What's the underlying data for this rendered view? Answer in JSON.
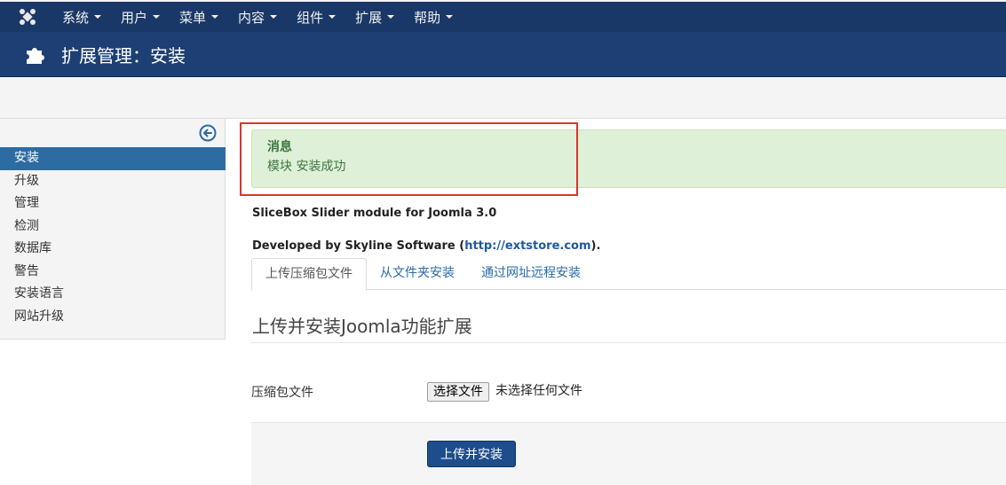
{
  "nav": {
    "items": [
      {
        "label": "系统"
      },
      {
        "label": "用户"
      },
      {
        "label": "菜单"
      },
      {
        "label": "内容"
      },
      {
        "label": "组件"
      },
      {
        "label": "扩展"
      },
      {
        "label": "帮助"
      }
    ]
  },
  "header": {
    "title": "扩展管理：安装"
  },
  "sidebar": {
    "items": [
      {
        "label": "安装",
        "active": true
      },
      {
        "label": "升级"
      },
      {
        "label": "管理"
      },
      {
        "label": "检测"
      },
      {
        "label": "数据库"
      },
      {
        "label": "警告"
      },
      {
        "label": "安装语言"
      },
      {
        "label": "网站升级"
      }
    ]
  },
  "alert": {
    "heading": "消息",
    "message": "模块 安装成功"
  },
  "description": {
    "line1": "SliceBox Slider module for Joomla 3.0",
    "line2_prefix": "Developed by Skyline Software (",
    "line2_link": "http://extstore.com",
    "line2_suffix": ")."
  },
  "tabs": [
    {
      "label": "上传压缩包文件",
      "active": true
    },
    {
      "label": "从文件夹安装"
    },
    {
      "label": "通过网址远程安装"
    }
  ],
  "form": {
    "section_title": "上传并安装Joomla功能扩展",
    "field_label": "压缩包文件",
    "file_button": "选择文件",
    "file_status": "未选择任何文件",
    "submit_label": "上传并安装"
  },
  "colors": {
    "nav_bg": "#1a3867",
    "title_bg": "#1d3f73",
    "active_sidebar": "#2d6ca2",
    "alert_bg": "#dff0d8",
    "alert_text": "#3c763d",
    "highlight": "#e0322c",
    "submit_bg": "#1d4d8b"
  }
}
